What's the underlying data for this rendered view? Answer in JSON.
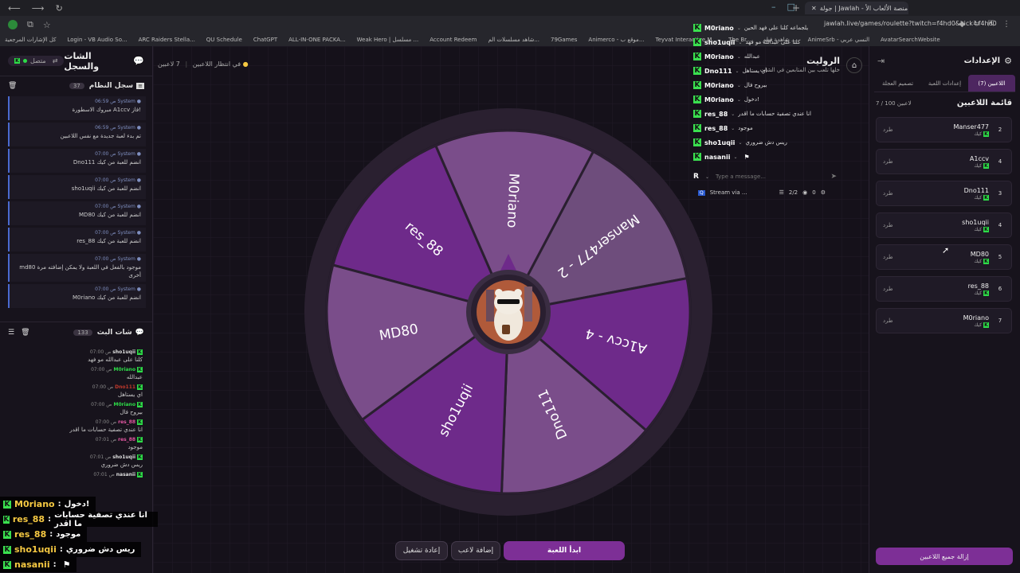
{
  "browser": {
    "tabs": [
      "جولة | Jawlah - منصة الألعاب الأ"
    ],
    "url": "jawlah.live/games/roulette?twitch=f4hd0&kick=f4hd0",
    "bookmarks": [
      "كل الإشارات المرجعية",
      "Login - VB Audio So...",
      "ARC Raiders Stella...",
      "QU Schedule",
      "ChatGPT",
      "ALL-IN-ONE PACKA...",
      "Weak Hero | مسلسل ...",
      "Account Redeem",
      "شاهد مسلسلات الم...",
      "79Games",
      "Animerco - موقع ب...",
      "Teyvat Interactive M...",
      "The Br...",
      "شاهدة فيلم ...",
      "AnimeSrb - النسي عربي",
      "AvatarSearchWebsite"
    ]
  },
  "left_panel": {
    "title": "الشات والسجل",
    "connection": "متصل",
    "system_log": {
      "title": "سجل النظام",
      "count": "37",
      "messages": [
        {
          "sender": "System",
          "time": "06:59 ص",
          "text": "مبروك الاسطورة A1ccv فاز!"
        },
        {
          "sender": "System",
          "time": "06:59 ص",
          "text": "تم بدء لعبة جديدة مع نفس اللاعبين"
        },
        {
          "sender": "System",
          "time": "07:00 ص",
          "text": "Dno111 انضم للعبة من كيك"
        },
        {
          "sender": "System",
          "time": "07:00 ص",
          "text": "sho1uqii انضم للعبة من كيك"
        },
        {
          "sender": "System",
          "time": "07:00 ص",
          "text": "MD80 انضم للعبة من كيك"
        },
        {
          "sender": "System",
          "time": "07:00 ص",
          "text": "res_88 انضم للعبة من كيك"
        },
        {
          "sender": "System",
          "time": "07:00 ص",
          "text": "md80 موجود بالفعل في اللعبة ولا يمكن إضافته مرة أخرى"
        },
        {
          "sender": "System",
          "time": "07:00 ص",
          "text": "M0riano انضم للعبة من كيك"
        }
      ]
    },
    "stream_chat": {
      "title": "شات البث",
      "count": "133",
      "messages": [
        {
          "name": "sho1uqii",
          "time": "07:00 ص",
          "color": "#dddddd",
          "text": "كلنا على عبدالله مو فهد"
        },
        {
          "name": "M0riano",
          "time": "07:00 ص",
          "color": "#2ddc48",
          "text": "عبدالله"
        },
        {
          "name": "Dno111",
          "time": "07:00 ص",
          "color": "#c0392b",
          "text": "اي يستاهل"
        },
        {
          "name": "M0riano",
          "time": "07:00 ص",
          "color": "#2ddc48",
          "text": "بيروح فال"
        },
        {
          "name": "res_88",
          "time": "07:00 ص",
          "color": "#e056a0",
          "text": "انا عندي تصفية حسابات ما اقدر"
        },
        {
          "name": "res_88",
          "time": "07:01 ص",
          "color": "#e056a0",
          "text": "موجود"
        },
        {
          "name": "sho1uqii",
          "time": "07:01 ص",
          "color": "#dddddd",
          "text": "ريس دش ضروري"
        },
        {
          "name": "nasanii",
          "time": "07:01 ص",
          "color": "#dddddd",
          "text": ""
        }
      ]
    }
  },
  "overlay_chat": [
    {
      "name": "M0riano",
      "text": "دخول!"
    },
    {
      "name": "res_88",
      "text": "انا عندي تصفية حسابات ما اقدر"
    },
    {
      "name": "res_88",
      "text": "موجود"
    },
    {
      "name": "sho1uqii",
      "text": "ريس دش ضروري"
    },
    {
      "name": "nasanii",
      "text": ""
    }
  ],
  "center": {
    "status_waiting": "في انتظار اللاعبين",
    "status_count": "7 لاعبين",
    "title": "الروليت",
    "subtitle": "خلها تلعب بين المتابعين في الشات"
  },
  "twitch_chat": [
    {
      "name": "M0riano",
      "text": "يلجماعه كلنا على فهد الحين"
    },
    {
      "name": "sho1uqii",
      "text": "كلنا على عبدالله مو فهد"
    },
    {
      "name": "M0riano",
      "text": "عبدالله"
    },
    {
      "name": "Dno111",
      "text": "اي يستاهل"
    },
    {
      "name": "M0riano",
      "text": "بيروح فال"
    },
    {
      "name": "M0riano",
      "text": "دخول!"
    },
    {
      "name": "res_88",
      "text": "انا عندي تصفية حسابات ما اقدر"
    },
    {
      "name": "res_88",
      "text": "موجود"
    },
    {
      "name": "sho1uqii",
      "text": "ريس دش ضروري"
    },
    {
      "name": "nasanii",
      "text": ""
    }
  ],
  "twitch_input": {
    "placeholder": "Type a message...",
    "avatar_letter": "R"
  },
  "stream_widget": {
    "label": "Stream via ...",
    "viewers": "2/2",
    "likes": "0"
  },
  "wheel": {
    "segments": [
      {
        "label": "res_88",
        "color": "#6e2a8a"
      },
      {
        "label": "M0riano",
        "color": "#7a4d8a"
      },
      {
        "label": "Manser477 - 2",
        "color": "#6e4d7c"
      },
      {
        "label": "A1ccv - 4",
        "color": "#6e2a8a"
      },
      {
        "label": "Dno111",
        "color": "#7a4d8a"
      },
      {
        "label": "sho1uqii",
        "color": "#6e2a8a"
      },
      {
        "label": "MD80",
        "color": "#7a4d8a"
      }
    ]
  },
  "buttons": {
    "start": "ابدأ اللعبة",
    "add_player": "إضافة لاعب",
    "restart": "إعادة تشغيل"
  },
  "right_panel": {
    "title": "الإعدادات",
    "tabs": [
      "اللاعبين (7)",
      "إعدادات اللعبة",
      "تصميم العجلة"
    ],
    "list_title": "قائمة اللاعبين",
    "capacity": "7 / 100 لاعبين",
    "kick_label": "طرد",
    "source_label": "كيك",
    "players": [
      {
        "name": "Manser477",
        "num": "2"
      },
      {
        "name": "A1ccv",
        "num": "4"
      },
      {
        "name": "Dno111",
        "num": "3"
      },
      {
        "name": "sho1uqii",
        "num": "4"
      },
      {
        "name": "MD80",
        "num": "5"
      },
      {
        "name": "res_88",
        "num": "6"
      },
      {
        "name": "M0riano",
        "num": "7"
      }
    ],
    "remove_all": "إزالة جميع اللاعبين"
  }
}
